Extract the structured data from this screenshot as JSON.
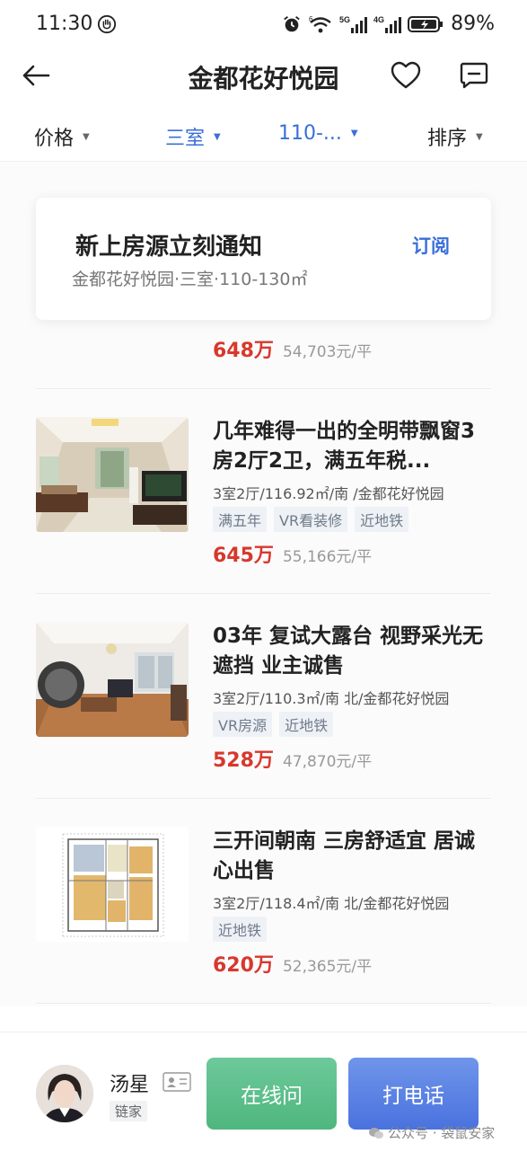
{
  "status_bar": {
    "time": "11:30",
    "network_labels": [
      "5G",
      "4G"
    ],
    "battery": "89%"
  },
  "nav": {
    "title": "金都花好悦园"
  },
  "filters": [
    {
      "label": "价格",
      "active": false
    },
    {
      "label": "三室",
      "active": true
    },
    {
      "label": "110-...",
      "active": true
    },
    {
      "label": "排序",
      "active": false
    }
  ],
  "subscribe": {
    "title": "新上房源立刻通知",
    "link": "订阅",
    "desc": "金都花好悦园·三室·110-130㎡"
  },
  "partial_listing": {
    "price": "648万",
    "unit_price": "54,703元/平"
  },
  "listings": [
    {
      "title": "几年难得一出的全明带飘窗3房2厅2卫，满五年税...",
      "meta": "3室2厅/116.92㎡/南 /金都花好悦园",
      "tags": [
        "满五年",
        "VR看装修",
        "近地铁"
      ],
      "price": "645万",
      "unit_price": "55,166元/平"
    },
    {
      "title": "03年 复试大露台 视野采光无遮挡 业主诚售",
      "meta": "3室2厅/110.3㎡/南 北/金都花好悦园",
      "tags": [
        "VR房源",
        "近地铁"
      ],
      "price": "528万",
      "unit_price": "47,870元/平"
    },
    {
      "title": "三开间朝南 三房舒适宜 居诚心出售",
      "meta": "3室2厅/118.4㎡/南 北/金都花好悦园",
      "tags": [
        "近地铁"
      ],
      "price": "620万",
      "unit_price": "52,365元/平"
    }
  ],
  "agent": {
    "name": "汤星",
    "company": "链家"
  },
  "actions": {
    "chat_label": "在线问",
    "call_label": "打电话"
  },
  "watermark": "公众号 · 袋鼠安家",
  "colors": {
    "accent": "#3a6fd8",
    "price": "#d8382c",
    "chat_button": "#5bbf8a",
    "call_button": "#5a82e4"
  }
}
